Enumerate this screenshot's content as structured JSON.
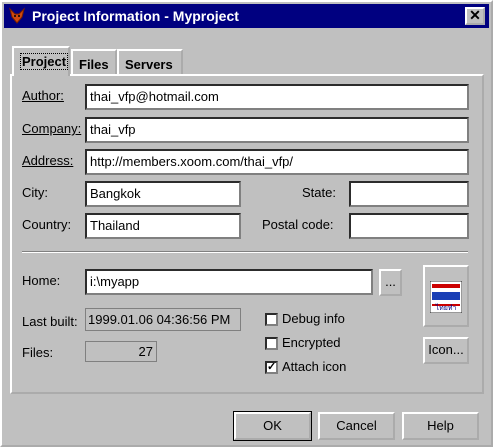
{
  "window": {
    "title": "Project Information - Myproject",
    "close_glyph": "✕"
  },
  "tabs": [
    {
      "label": "Project"
    },
    {
      "label": "Files"
    },
    {
      "label": "Servers"
    }
  ],
  "form": {
    "author_label": "Author:",
    "author_value": "thai_vfp@hotmail.com",
    "company_label": "Company:",
    "company_value": "thai_vfp",
    "address_label": "Address:",
    "address_value": "http://members.xoom.com/thai_vfp/",
    "city_label": "City:",
    "city_value": "Bangkok",
    "state_label": "State:",
    "state_value": "",
    "country_label": "Country:",
    "country_value": "Thailand",
    "postal_label": "Postal code:",
    "postal_value": "",
    "home_label": "Home:",
    "home_value": "i:\\myapp",
    "browse_label": "...",
    "last_built_label": "Last built:",
    "last_built_value": "1999.01.06 04:36:56 PM",
    "files_label": "Files:",
    "files_value": "27",
    "debug_label": "Debug info",
    "debug_checked": false,
    "encrypted_label": "Encrypted",
    "encrypted_checked": false,
    "attach_icon_label": "Attach icon",
    "attach_icon_checked": true,
    "icon_button_label": "Icon...",
    "icon_caption": "ไทยทำ"
  },
  "buttons": {
    "ok": "OK",
    "cancel": "Cancel",
    "help": "Help"
  },
  "colors": {
    "titlebar": "#000080",
    "face": "#c0c0c0",
    "flag_red": "#cc0000",
    "flag_blue": "#1a3fb5"
  }
}
